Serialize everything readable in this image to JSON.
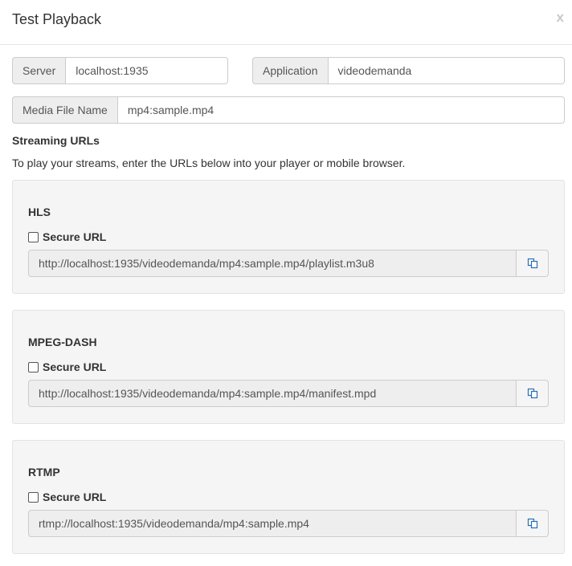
{
  "modal": {
    "title": "Test Playback",
    "close_label": "x"
  },
  "form": {
    "server": {
      "label": "Server",
      "value": "localhost:1935"
    },
    "application": {
      "label": "Application",
      "value": "videodemanda"
    },
    "media_file": {
      "label": "Media File Name",
      "value": "mp4:sample.mp4"
    }
  },
  "streaming": {
    "title": "Streaming URLs",
    "description": "To play your streams, enter the URLs below into your player or mobile browser.",
    "panels": [
      {
        "title": "HLS",
        "secure_label": "Secure URL",
        "secure_checked": false,
        "url": "http://localhost:1935/videodemanda/mp4:sample.mp4/playlist.m3u8"
      },
      {
        "title": "MPEG-DASH",
        "secure_label": "Secure URL",
        "secure_checked": false,
        "url": "http://localhost:1935/videodemanda/mp4:sample.mp4/manifest.mpd"
      },
      {
        "title": "RTMP",
        "secure_label": "Secure URL",
        "secure_checked": false,
        "url": "rtmp://localhost:1935/videodemanda/mp4:sample.mp4"
      }
    ]
  },
  "icons": {
    "copy": "copy-icon",
    "accent_color": "#2a6db5"
  }
}
